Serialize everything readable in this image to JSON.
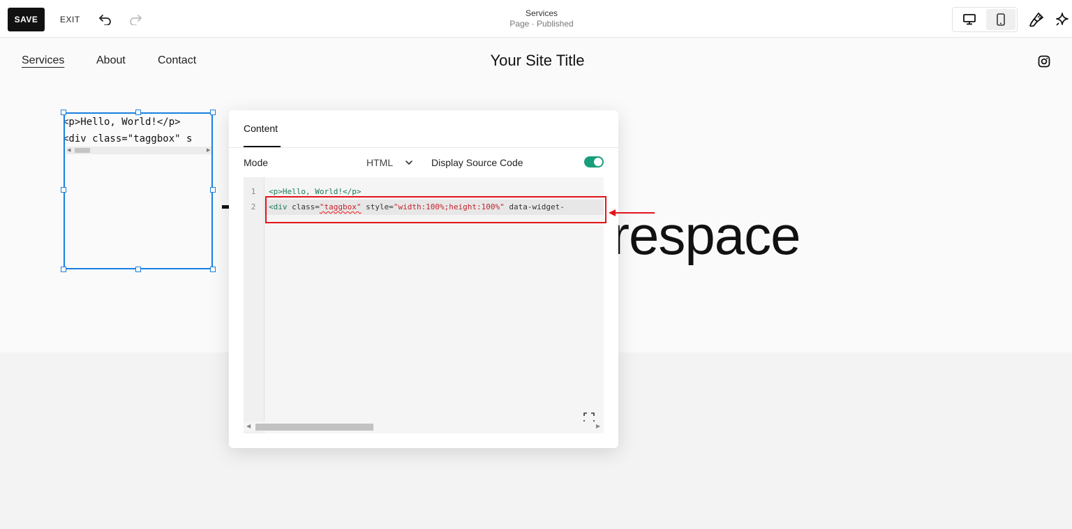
{
  "toolbar": {
    "save_label": "SAVE",
    "exit_label": "EXIT",
    "page_name": "Services",
    "page_status": "Page · Published",
    "icons": [
      "undo-icon",
      "redo-icon",
      "desktop-icon",
      "mobile-icon",
      "paintbrush-icon",
      "sparkle-icon"
    ]
  },
  "site": {
    "nav": [
      "Services",
      "About",
      "Contact"
    ],
    "title": "Your Site Title",
    "heading_visible": "respace"
  },
  "code_block": {
    "lines": [
      "<p>Hello, World!</p>",
      "<div class=\"taggbox\" s"
    ]
  },
  "panel": {
    "tab": "Content",
    "mode_label": "Mode",
    "mode_value": "HTML",
    "display_source_label": "Display Source Code",
    "display_source_on": true,
    "editor": {
      "line_numbers": [
        "1",
        "2"
      ],
      "line1": "<p>Hello, World!</p>",
      "line2_parts": {
        "open": "<div",
        "class_attr": " class=",
        "class_val": "\"taggbox\"",
        "style_attr": " style=",
        "style_val": "\"width:100%;height:100%\"",
        "rest": " data-widget-"
      }
    }
  },
  "colors": {
    "selection": "#1a7fe0",
    "toggle_on": "#179e7a",
    "annotation": "#e3141b",
    "tag": "#1b7a5a",
    "string": "#c4242b"
  }
}
